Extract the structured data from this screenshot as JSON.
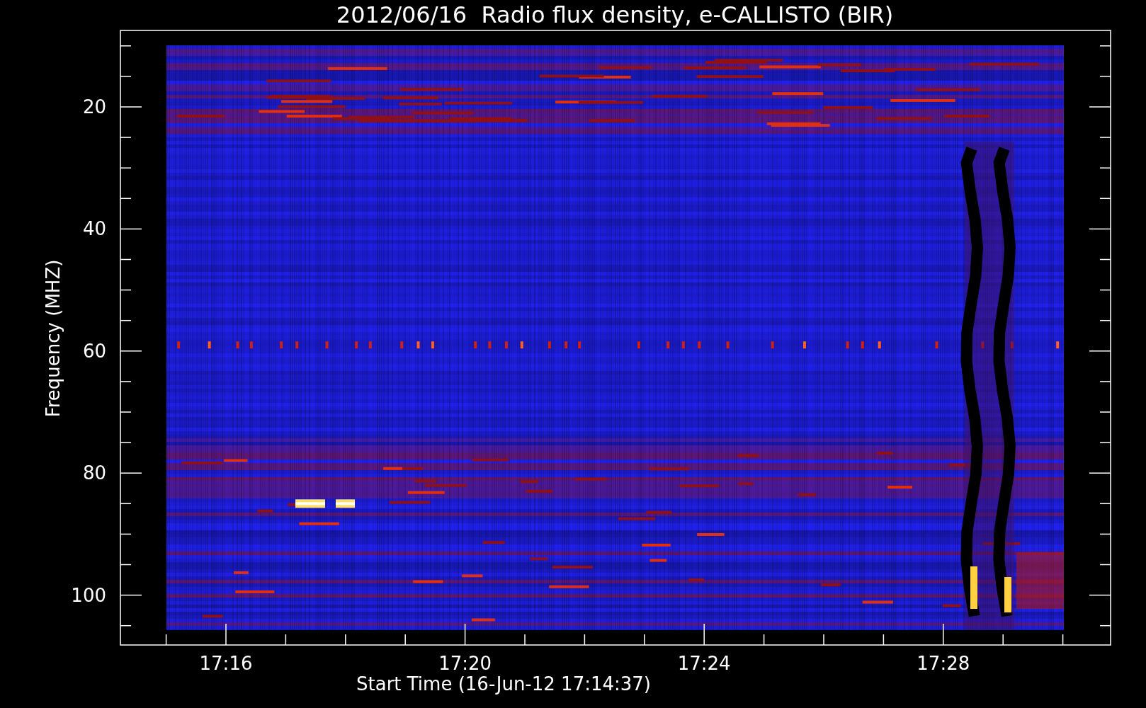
{
  "title": "2012/06/16  Radio flux density, e-CALLISTO (BIR)",
  "x_axis": {
    "label": "Start Time (16-Jun-12 17:14:37)",
    "ticks": [
      "17:16",
      "17:20",
      "17:24",
      "17:28"
    ]
  },
  "y_axis": {
    "label": "Frequency (MHZ)",
    "ticks": [
      "20",
      "40",
      "60",
      "80",
      "100"
    ]
  }
}
